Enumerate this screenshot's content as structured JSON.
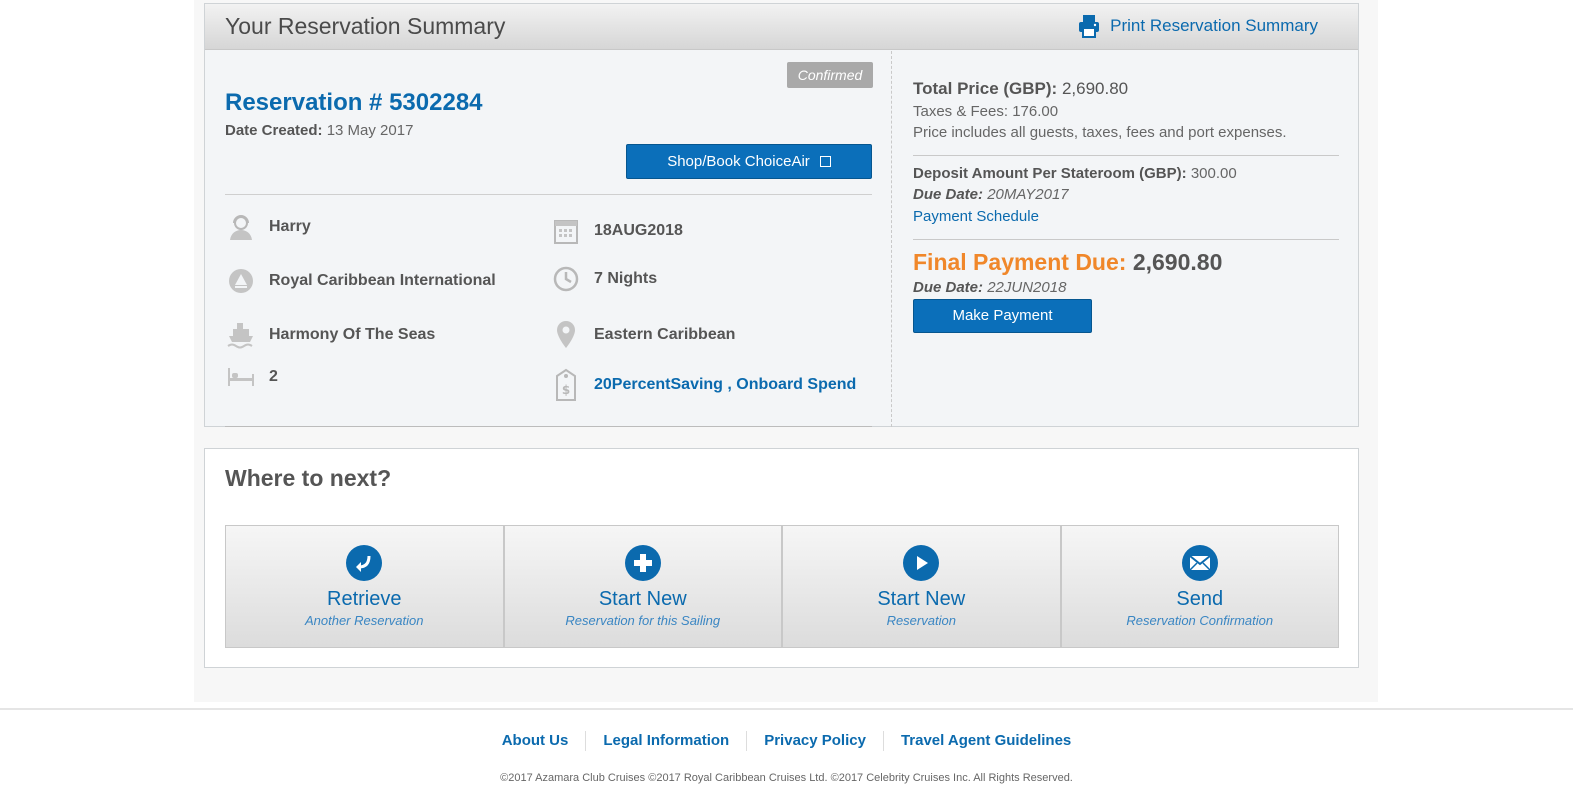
{
  "summary": {
    "title": "Your Reservation Summary",
    "print_label": "Print Reservation Summary",
    "status": "Confirmed",
    "reservation_number": "Reservation # 5302284",
    "date_created_label": "Date Created:",
    "date_created_value": "13 May 2017",
    "choiceair_label": "Shop/Book ChoiceAir",
    "details": {
      "guest": "Harry",
      "sail_date": "18AUG2018",
      "cruise_line": "Royal Caribbean International",
      "nights": "7 Nights",
      "ship": "Harmony Of The Seas",
      "itinerary": "Eastern Caribbean",
      "staterooms": "2",
      "promotions": "20PercentSaving , Onboard Spend"
    },
    "pricing": {
      "total_label": "Total Price (GBP):",
      "total_value": "2,690.80",
      "taxes": "Taxes & Fees: 176.00",
      "includes": "Price includes all guests, taxes, fees and port expenses.",
      "deposit_label": "Deposit Amount Per Stateroom (GBP):",
      "deposit_value": "300.00",
      "due_label": "Due Date:",
      "deposit_due": "20MAY2017",
      "schedule_link": "Payment Schedule",
      "final_label": "Final Payment Due:",
      "final_value": "2,690.80",
      "final_due": "22JUN2018",
      "pay_button": "Make Payment"
    }
  },
  "next": {
    "title": "Where to next?",
    "tiles": [
      {
        "title": "Retrieve",
        "subtitle": "Another Reservation",
        "icon": "retrieve-arrow-icon"
      },
      {
        "title": "Start New",
        "subtitle": "Reservation for this Sailing",
        "icon": "plus-icon"
      },
      {
        "title": "Start New",
        "subtitle": "Reservation",
        "icon": "play-icon"
      },
      {
        "title": "Send",
        "subtitle": "Reservation Confirmation",
        "icon": "envelope-icon"
      }
    ]
  },
  "footer": {
    "links": [
      "About Us",
      "Legal Information",
      "Privacy Policy",
      "Travel Agent Guidelines"
    ],
    "copyright": "©2017 Azamara Club Cruises ©2017 Royal Caribbean Cruises Ltd. ©2017 Celebrity Cruises Inc. All Rights Reserved."
  },
  "colors": {
    "brand_blue": "#0b6aae",
    "final_orange": "#f0872a",
    "badge_gray": "#a9a9a9"
  }
}
